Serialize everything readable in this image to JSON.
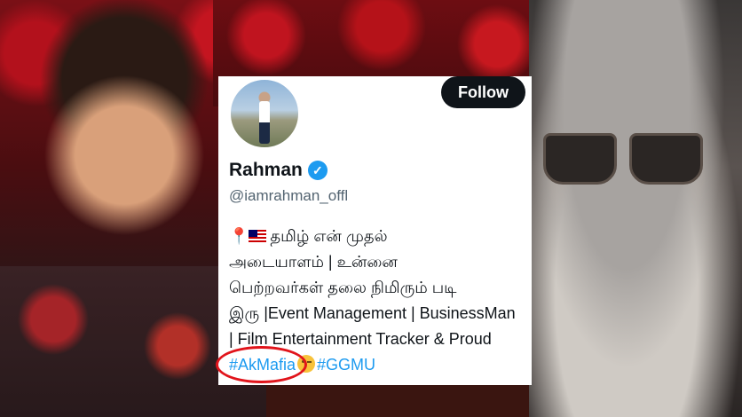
{
  "profile": {
    "follow_label": "Follow",
    "display_name": "Rahman",
    "verified_icon": "verified-badge-icon",
    "handle": "@iamrahman_offl",
    "bio": {
      "line1": "தமிழ் என் முதல்",
      "line2": "அடையாளம் | உன்னை",
      "line3": "பெற்றவர்கள் தலை நிமிரும் படி",
      "line4": "இரு |Event Management | BusinessMan",
      "line5": "| Film Entertainment Tracker & Proud",
      "hashtag1": "#AkMafia",
      "hashtag2": "#GGMU"
    }
  },
  "colors": {
    "accent": "#1d9bf0",
    "follow_bg": "#0f1419",
    "highlight": "#e1141b"
  }
}
